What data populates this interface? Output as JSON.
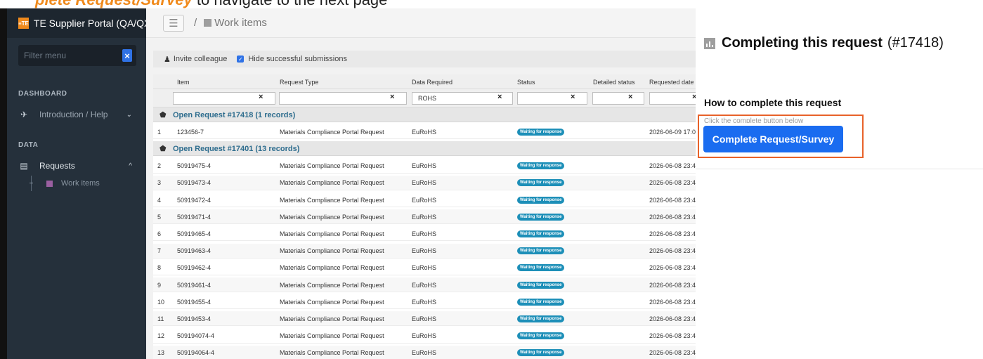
{
  "banner": {
    "accent_text": "plete Request/Survey",
    "text": " to navigate to the next page"
  },
  "brand": {
    "logo_text": "≡TE",
    "title": "TE Supplier Portal (QA/QX)"
  },
  "sidebar": {
    "filter_placeholder": "Filter menu",
    "filter_clear": "×",
    "sections": [
      {
        "title": "DASHBOARD",
        "items": [
          {
            "label": "Introduction / Help",
            "icon": "rocket-icon",
            "chevron": "⌄"
          }
        ]
      },
      {
        "title": "DATA",
        "items": [
          {
            "label": "Requests",
            "icon": "document-icon",
            "chevron": "^"
          }
        ]
      }
    ],
    "sub_items": [
      {
        "label": "Work items",
        "icon": "chart-icon"
      }
    ]
  },
  "topbar": {
    "menu_glyph": "☰",
    "separator": "/",
    "crumb": "Work items"
  },
  "toolbar": {
    "invite_label": "Invite colleague",
    "hide_label": "Hide successful submissions",
    "hide_checked": true
  },
  "table": {
    "columns": [
      "Item",
      "Request Type",
      "Data Required",
      "Status",
      "Detailed status",
      "Requested date"
    ],
    "filters": [
      "",
      "",
      "ROHS",
      "",
      "",
      ""
    ],
    "groups": [
      {
        "label": "Open Request #17418 (1 records)",
        "rows": [
          {
            "n": "1",
            "item": "123456-7",
            "type": "Materials Compliance Portal Request",
            "data": "EuRoHS",
            "status": "Waiting for response",
            "detail": "",
            "date": "2026-06-09 17:0"
          }
        ]
      },
      {
        "label": "Open Request #17401 (13 records)",
        "rows": [
          {
            "n": "2",
            "item": "50919475-4",
            "type": "Materials Compliance Portal Request",
            "data": "EuRoHS",
            "status": "Waiting for response",
            "detail": "",
            "date": "2026-06-08 23:4"
          },
          {
            "n": "3",
            "item": "50919473-4",
            "type": "Materials Compliance Portal Request",
            "data": "EuRoHS",
            "status": "Waiting for response",
            "detail": "",
            "date": "2026-06-08 23:4"
          },
          {
            "n": "4",
            "item": "50919472-4",
            "type": "Materials Compliance Portal Request",
            "data": "EuRoHS",
            "status": "Waiting for response",
            "detail": "",
            "date": "2026-06-08 23:4"
          },
          {
            "n": "5",
            "item": "50919471-4",
            "type": "Materials Compliance Portal Request",
            "data": "EuRoHS",
            "status": "Waiting for response",
            "detail": "",
            "date": "2026-06-08 23:4"
          },
          {
            "n": "6",
            "item": "50919465-4",
            "type": "Materials Compliance Portal Request",
            "data": "EuRoHS",
            "status": "Waiting for response",
            "detail": "",
            "date": "2026-06-08 23:4"
          },
          {
            "n": "7",
            "item": "50919463-4",
            "type": "Materials Compliance Portal Request",
            "data": "EuRoHS",
            "status": "Waiting for response",
            "detail": "",
            "date": "2026-06-08 23:4"
          },
          {
            "n": "8",
            "item": "50919462-4",
            "type": "Materials Compliance Portal Request",
            "data": "EuRoHS",
            "status": "Waiting for response",
            "detail": "",
            "date": "2026-06-08 23:4"
          },
          {
            "n": "9",
            "item": "50919461-4",
            "type": "Materials Compliance Portal Request",
            "data": "EuRoHS",
            "status": "Waiting for response",
            "detail": "",
            "date": "2026-06-08 23:4"
          },
          {
            "n": "10",
            "item": "50919455-4",
            "type": "Materials Compliance Portal Request",
            "data": "EuRoHS",
            "status": "Waiting for response",
            "detail": "",
            "date": "2026-06-08 23:4"
          },
          {
            "n": "11",
            "item": "50919453-4",
            "type": "Materials Compliance Portal Request",
            "data": "EuRoHS",
            "status": "Waiting for response",
            "detail": "",
            "date": "2026-06-08 23:4"
          },
          {
            "n": "12",
            "item": "509194074-4",
            "type": "Materials Compliance Portal Request",
            "data": "EuRoHS",
            "status": "Waiting for response",
            "detail": "",
            "date": "2026-06-08 23:4"
          },
          {
            "n": "13",
            "item": "509194064-4",
            "type": "Materials Compliance Portal Request",
            "data": "EuRoHS",
            "status": "Waiting for response",
            "detail": "",
            "date": "2026-06-08 23:4"
          }
        ]
      }
    ]
  },
  "panel": {
    "title": "Completing this request",
    "request_id": "(#17418)",
    "subtitle": "How to complete this request",
    "hint": "Click the complete button below",
    "button_label": "Complete Request/Survey"
  },
  "colors": {
    "accent": "#f08a1c",
    "sidebar": "#25303b",
    "button": "#1a6cf0",
    "highlight": "#e8622a",
    "badge": "#1d8fb8"
  }
}
